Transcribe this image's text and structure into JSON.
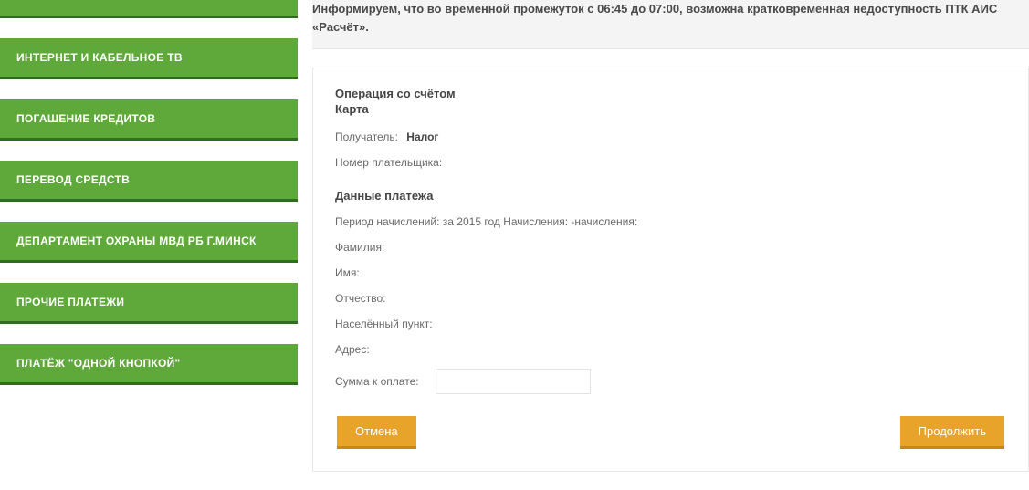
{
  "sidebar": {
    "items": [
      {
        "label": ""
      },
      {
        "label": "ИНТЕРНЕТ И КАБЕЛЬНОЕ ТВ"
      },
      {
        "label": "ПОГАШЕНИЕ КРЕДИТОВ"
      },
      {
        "label": "ПЕРЕВОД СРЕДСТВ"
      },
      {
        "label": "ДЕПАРТАМЕНТ ОХРАНЫ МВД РБ Г.МИНСК"
      },
      {
        "label": "ПРОЧИЕ ПЛАТЕЖИ"
      },
      {
        "label": "ПЛАТЁЖ \"ОДНОЙ КНОПКОЙ\""
      }
    ]
  },
  "notice": "Информируем, что во временной промежуток с 06:45 до 07:00, возможна кратковременная недоступность ПТК АИС «Расчёт».",
  "panel": {
    "operation_title": "Операция со счётом",
    "card_line": "Карта",
    "recipient_label": "Получатель:",
    "recipient_value": "Налог",
    "payer_number_label": "Номер плательщика:",
    "payer_number_value": "",
    "payment_data_title": "Данные платежа",
    "period_line": "Период начислений: за 2015 год Начисления: -начисления:",
    "lastname_label": "Фамилия:",
    "lastname_value": "",
    "firstname_label": "Имя:",
    "firstname_value": "",
    "patronymic_label": "Отчество:",
    "patronymic_value": "",
    "locality_label": "Населённый пункт:",
    "locality_value": "",
    "address_label": "Адрес:",
    "address_value": "",
    "amount_label": "Сумма к оплате:",
    "amount_value": ""
  },
  "actions": {
    "cancel": "Отмена",
    "continue": "Продолжить"
  }
}
